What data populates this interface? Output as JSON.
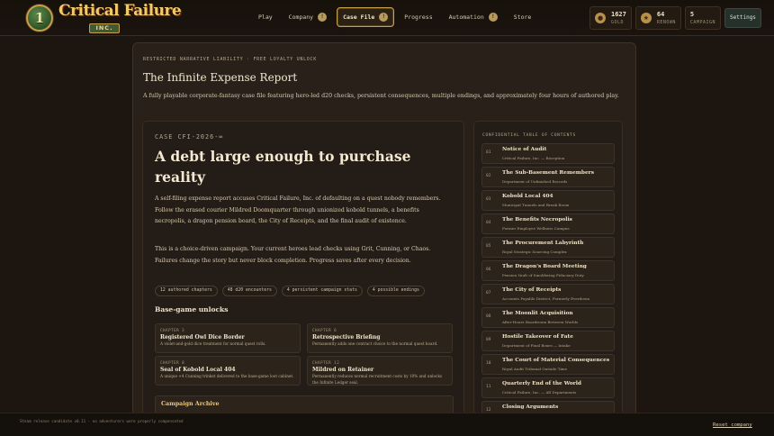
{
  "brand": {
    "medal": "1",
    "title": "Critical Failure",
    "sub": "INC.",
    "accent": "#f0c96a"
  },
  "nav": [
    {
      "label": "Play",
      "badge": ""
    },
    {
      "label": "Company",
      "badge": "!"
    },
    {
      "label": "Case File",
      "badge": "!",
      "active": true
    },
    {
      "label": "Progress",
      "badge": ""
    },
    {
      "label": "Automation",
      "badge": "!"
    },
    {
      "label": "Store",
      "badge": ""
    }
  ],
  "stats": [
    {
      "icon": "coin-icon",
      "glyph": "●",
      "value": "1627",
      "label": "GOLD"
    },
    {
      "icon": "renown-icon",
      "glyph": "★",
      "value": "64",
      "label": "RENOWN"
    },
    {
      "icon": "",
      "glyph": "",
      "value": "5",
      "label": "CAMPAIGN"
    }
  ],
  "settings_label": "Settings",
  "panel": {
    "eyebrow": "RESTRICTED NARRATIVE LIABILITY · FREE LOYALTY UNLOCK",
    "title": "The Infinite Expense Report",
    "subtitle": "A fully playable corporate-fantasy case file featuring hero-led d20 checks, persistent consequences, multiple endings, and approximately four hours of authored play."
  },
  "case": {
    "id": "CASE CFI-2026-∞",
    "headline": "A debt large enough to purchase reality",
    "body1": "A self-filing expense report accuses Critical Failure, Inc. of defaulting on a quest nobody remembers. Follow the erased courier Mildred Doomquarter through unionized kobold tunnels, a benefits necropolis, a dragon pension board, the City of Receipts, and the final audit of existence.",
    "body2": "This is a choice-driven campaign. Your current heroes lead checks using Grit, Cunning, or Chaos. Failures change the story but never block completion. Progress saves after every decision.",
    "chips": [
      "12 authored chapters",
      "48 d20 encounters",
      "4 persistent campaign stats",
      "4 possible endings"
    ],
    "unlocks_heading": "Base-game unlocks",
    "unlocks": [
      {
        "chapter": "CHAPTER 3",
        "title": "Registered Owl Dice Border",
        "desc": "A violet-and-gold dice treatment for normal quest rolls."
      },
      {
        "chapter": "CHAPTER 6",
        "title": "Retrospective Briefing",
        "desc": "Permanently adds one contract choice to the normal quest board."
      },
      {
        "chapter": "CHAPTER 8",
        "title": "Seal of Kobold Local 404",
        "desc": "A unique +4 Cunning trinket delivered to the base-game loot cabinet."
      },
      {
        "chapter": "CHAPTER 12",
        "title": "Mildred on Retainer",
        "desc": "Permanently reduces normal recruitment costs by 10% and unlocks the Infinite Ledger seal."
      }
    ],
    "archive_title": "Campaign Archive"
  },
  "toc": {
    "heading": "CONFIDENTIAL TABLE OF CONTENTS",
    "items": [
      {
        "num": "01",
        "title": "Notice of Audit",
        "sub": "Critical Failure, Inc. — Reception"
      },
      {
        "num": "02",
        "title": "The Sub-Basement Remembers",
        "sub": "Department of Unfinished Records"
      },
      {
        "num": "03",
        "title": "Kobold Local 404",
        "sub": "Municipal Tunnels and Break Room"
      },
      {
        "num": "04",
        "title": "The Benefits Necropolis",
        "sub": "Former Employee Wellness Campus"
      },
      {
        "num": "05",
        "title": "The Procurement Labyrinth",
        "sub": "Royal Strategic Sourcing Complex"
      },
      {
        "num": "06",
        "title": "The Dragon's Board Meeting",
        "sub": "Pension Vault of Smoldering Fiduciary Duty"
      },
      {
        "num": "07",
        "title": "The City of Receipts",
        "sub": "Accounts Payable District, Formerly Everdown"
      },
      {
        "num": "08",
        "title": "The Moonlit Acquisition",
        "sub": "After-Hours Boardroom Between Worlds"
      },
      {
        "num": "09",
        "title": "Hostile Takeover of Fate",
        "sub": "Department of Final Boxes — Intake"
      },
      {
        "num": "10",
        "title": "The Court of Material Consequences",
        "sub": "Royal Audit Tribunal Outside Time"
      },
      {
        "num": "11",
        "title": "Quarterly End of the World",
        "sub": "Critical Failure, Inc. — All Departments"
      },
      {
        "num": "12",
        "title": "Closing Arguments",
        "sub": ""
      }
    ]
  },
  "footer": {
    "note": "Steam release candidate v0.11 · no adventurers were properly compensated",
    "reset": "Reset company"
  }
}
